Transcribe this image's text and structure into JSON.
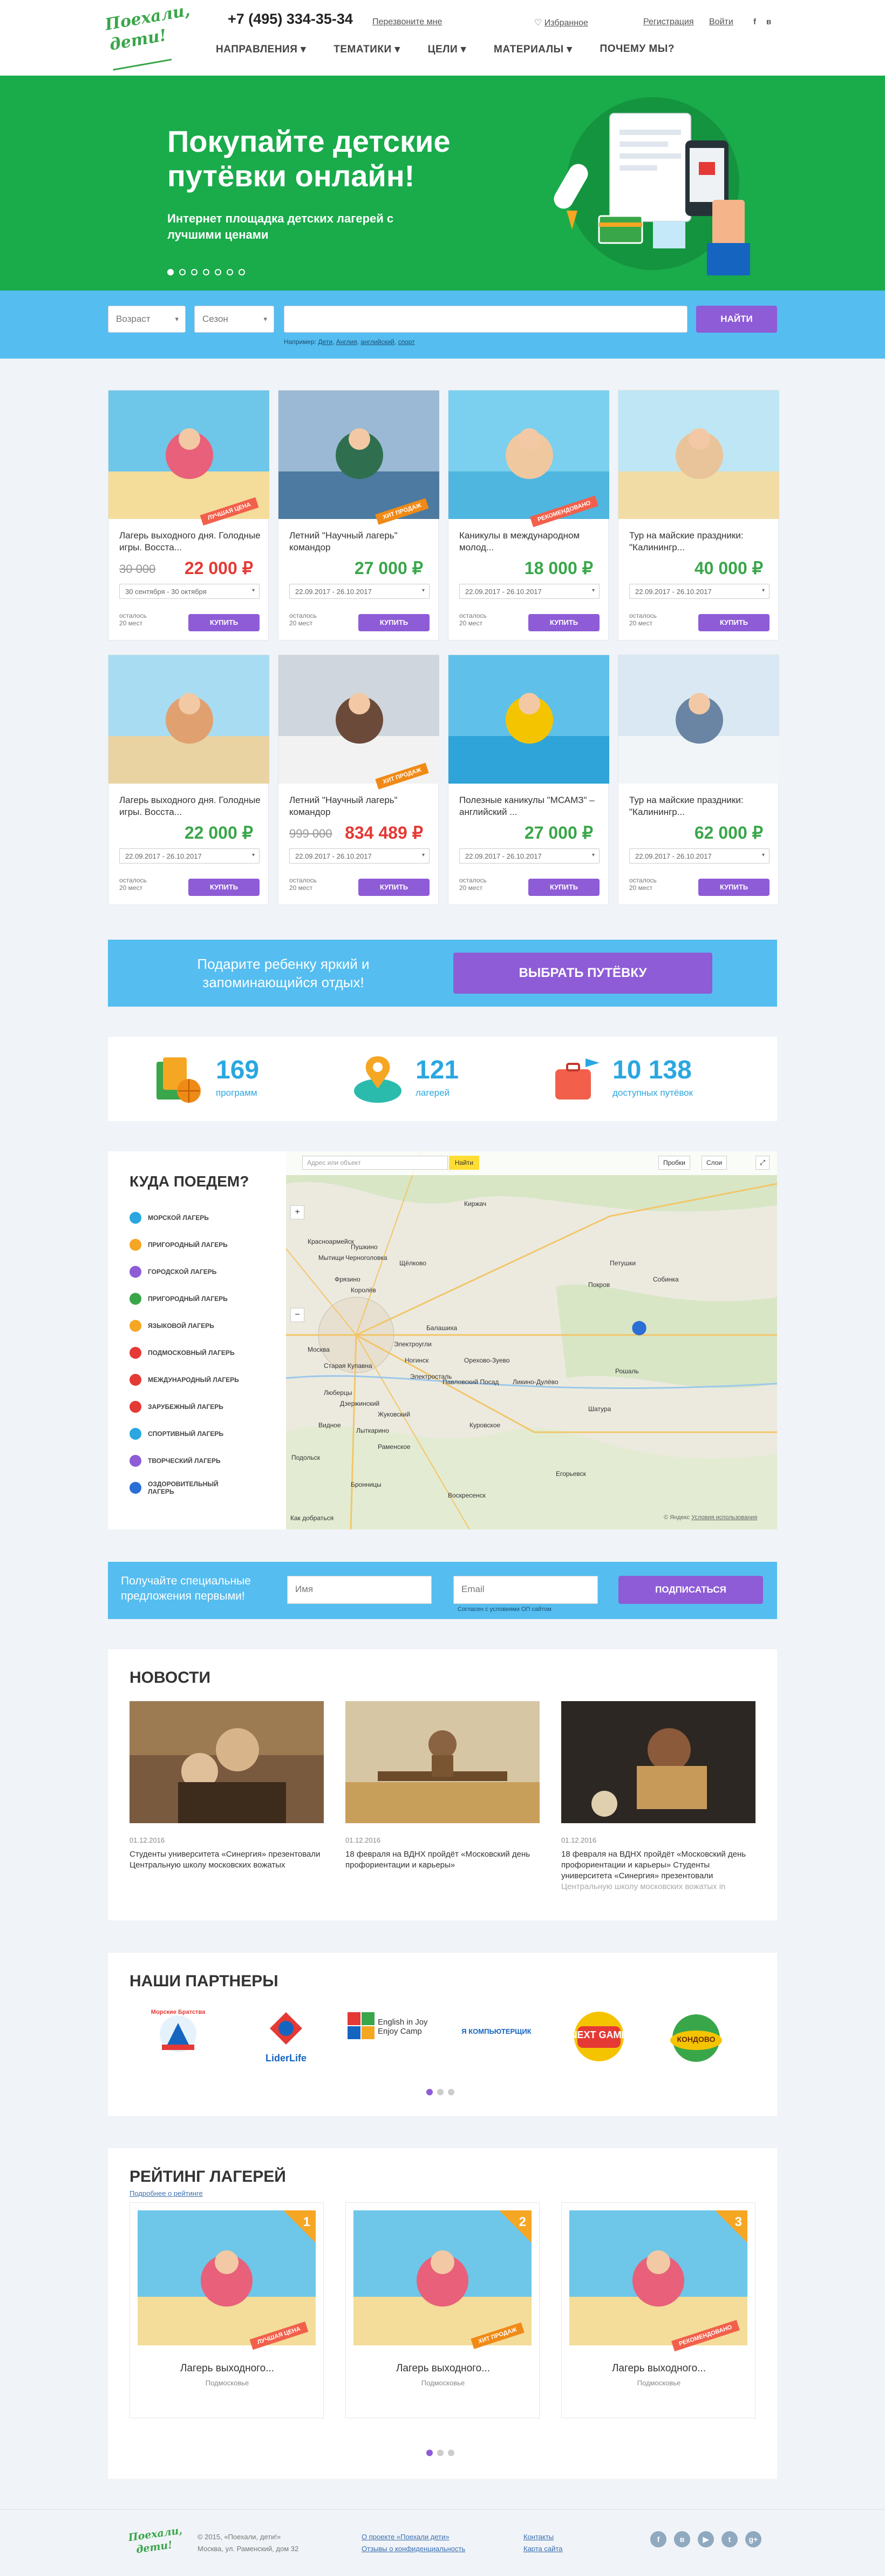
{
  "header": {
    "logo_text": "Поехали, дети!",
    "phone": "+7 (495) 334-35-34",
    "callback": "Перезвоните мне",
    "favorites": "Избранное",
    "register": "Регистрация",
    "login": "Войти",
    "social": [
      "f",
      "в"
    ],
    "nav": [
      {
        "label": "НАПРАВЛЕНИЯ",
        "arrow": "▾"
      },
      {
        "label": "ТЕМАТИКИ",
        "arrow": "▾"
      },
      {
        "label": "ЦЕЛИ",
        "arrow": "▾"
      },
      {
        "label": "МАТЕРИАЛЫ",
        "arrow": "▾"
      },
      {
        "label": "ПОЧЕМУ МЫ?",
        "arrow": ""
      }
    ]
  },
  "hero": {
    "title": "Покупайте детские путёвки онлайн!",
    "subtitle": "Интернет площадка детских лагерей с лучшими ценами",
    "slides": 7,
    "active_slide": 0
  },
  "search": {
    "age": "Возраст",
    "season": "Сезон",
    "button": "НАЙТИ",
    "hint_prefix": "Например:",
    "hint_links": [
      "Дети",
      "Англия",
      "английский",
      "спорт"
    ]
  },
  "cards": [
    {
      "title": "Лагерь выходного дня. Голодные игры. Восста...",
      "old_price": "30 000",
      "price": "22 000 ₽",
      "dates": "30 сентября - 30 октября",
      "left": "осталось",
      "left_count": "20 мест",
      "buy": "КУПИТЬ",
      "ribbon": "ЛУЧШАЯ ЦЕНА"
    },
    {
      "title": "Летний \"Научный лагерь\" командор",
      "old_price": "",
      "price": "27 000 ₽",
      "dates": "22.09.2017 - 26.10.2017",
      "left": "осталось",
      "left_count": "20 мест",
      "buy": "КУПИТЬ",
      "ribbon": "ХИТ ПРОДАЖ"
    },
    {
      "title": "Каникулы в международном молод...",
      "old_price": "",
      "price": "18 000 ₽",
      "dates": "22.09.2017 - 26.10.2017",
      "left": "осталось",
      "left_count": "20 мест",
      "buy": "КУПИТЬ",
      "ribbon": "РЕКОМЕНДОВАНО"
    },
    {
      "title": "Тур на майские праздники: \"Калинингр...",
      "old_price": "",
      "price": "40 000 ₽",
      "dates": "22.09.2017 - 26.10.2017",
      "left": "осталось",
      "left_count": "20 мест",
      "buy": "КУПИТЬ",
      "ribbon": ""
    },
    {
      "title": "Лагерь выходного дня. Голодные игры. Восста...",
      "old_price": "",
      "price": "22 000 ₽",
      "dates": "22.09.2017 - 26.10.2017",
      "left": "осталось",
      "left_count": "20 мест",
      "buy": "КУПИТЬ",
      "ribbon": ""
    },
    {
      "title": "Летний \"Научный лагерь\" командор",
      "old_price": "999 000",
      "price": "834 489 ₽",
      "dates": "22.09.2017 - 26.10.2017",
      "left": "осталось",
      "left_count": "20 мест",
      "buy": "КУПИТЬ",
      "ribbon": "ХИТ ПРОДАЖ"
    },
    {
      "title": "Полезные каникулы \"МСАМЗ\" – английский ...",
      "old_price": "",
      "price": "27 000 ₽",
      "dates": "22.09.2017 - 26.10.2017",
      "left": "осталось",
      "left_count": "20 мест",
      "buy": "КУПИТЬ",
      "ribbon": ""
    },
    {
      "title": "Тур на майские праздники: \"Калинингр...",
      "old_price": "",
      "price": "62 000 ₽",
      "dates": "22.09.2017 - 26.10.2017",
      "left": "осталось",
      "left_count": "20 мест",
      "buy": "КУПИТЬ",
      "ribbon": ""
    }
  ],
  "promo": {
    "text": "Подарите ребенку яркий и запоминающийся отдых!",
    "button": "ВЫБРАТЬ ПУТЁВКУ"
  },
  "stats": [
    {
      "value": "169",
      "label": "программ"
    },
    {
      "value": "121",
      "label": "лагерей"
    },
    {
      "value": "10 138",
      "label": "доступных путёвок"
    }
  ],
  "map_section": {
    "title": "КУДА ПОЕДЕМ?",
    "categories": [
      {
        "label": "МОРСКОЙ ЛАГЕРЬ",
        "color": "#2aa7e0"
      },
      {
        "label": "ПРИГОРОДНЫЙ ЛАГЕРЬ",
        "color": "#f5a623"
      },
      {
        "label": "ГОРОДСКОЙ ЛАГЕРЬ",
        "color": "#8e5cd6"
      },
      {
        "label": "ПРИГОРОДНЫЙ ЛАГЕРЬ",
        "color": "#3aa64a"
      },
      {
        "label": "ЯЗЫКОВОЙ ЛАГЕРЬ",
        "color": "#f5a623"
      },
      {
        "label": "ПОДМОСКОВНЫЙ ЛАГЕРЬ",
        "color": "#e53935"
      },
      {
        "label": "МЕЖДУНАРОДНЫЙ ЛАГЕРЬ",
        "color": "#e53935"
      },
      {
        "label": "ЗАРУБЕЖНЫЙ ЛАГЕРЬ",
        "color": "#e53935"
      },
      {
        "label": "СПОРТИВНЫЙ ЛАГЕРЬ",
        "color": "#2aa7e0"
      },
      {
        "label": "ТВОРЧЕСКИЙ ЛАГЕРЬ",
        "color": "#8e5cd6"
      },
      {
        "label": "ОЗДОРОВИТЕЛЬНЫЙ ЛАГЕРЬ",
        "color": "#2a6fd6"
      }
    ],
    "map": {
      "search_placeholder": "Адрес или объект",
      "find": "Найти",
      "traffic": "Пробки",
      "layers": "Слои",
      "route": "Как добраться",
      "copyright": "© Яндекс",
      "terms": "Условия использования",
      "towns": [
        "Мытищи",
        "Королёв",
        "Щёлково",
        "Балашиха",
        "Москва",
        "Люберцы",
        "Жуковский",
        "Раменское",
        "Электросталь",
        "Ногинск",
        "Орехово-Зуево",
        "Павловский Посад",
        "Куровское",
        "Шатура",
        "Рошаль",
        "Егорьевск",
        "Бронницы",
        "Воскресенск",
        "Пушкино",
        "Фрязино",
        "Красноармейск",
        "Черноголовка",
        "Киржач",
        "Петушки",
        "Покров",
        "Собинка",
        "Ликино-Дулёво",
        "Старая Купавна",
        "Электроугли",
        "Дзержинский",
        "Видное",
        "Подольск",
        "Лыткарино"
      ]
    }
  },
  "subscribe": {
    "text": "Получайте специальные предложения первыми!",
    "name_placeholder": "Имя",
    "email_placeholder": "Email",
    "button": "ПОДПИСАТЬСЯ",
    "agree": "Согласен с условиями ОП сайтом"
  },
  "news": {
    "title": "НОВОСТИ",
    "items": [
      {
        "date": "01.12.2016",
        "text": "Студенты университета «Синергия» презентовали Центральную школу московских вожатых",
        "fade": ""
      },
      {
        "date": "01.12.2016",
        "text": "18 февраля на ВДНХ пройдёт «Московский день профориентации и карьеры»",
        "fade": ""
      },
      {
        "date": "01.12.2016",
        "text": "18 февраля на ВДНХ пройдёт «Московский день профориентации и карьеры» Студенты университета «Синергия» презентовали",
        "fade": "Центральную школу московских вожатых in"
      }
    ]
  },
  "partners": {
    "title": "НАШИ ПАРТНЕРЫ",
    "items": [
      "Морские Братства",
      "LiderLife",
      "English in Joy Enjoy Camp",
      "Я КОМПЬЮТЕРЩИК",
      "NEXT GAME",
      "КОНДОВО"
    ]
  },
  "rating": {
    "title": "РЕЙТИНГ ЛАГЕРЕЙ",
    "more": "Подробнее о рейтинге",
    "items": [
      {
        "num": "1",
        "title": "Лагерь выходного...",
        "sub": "Подмосковье",
        "ribbon": "ЛУЧШАЯ ЦЕНА"
      },
      {
        "num": "2",
        "title": "Лагерь выходного...",
        "sub": "Подмосковье",
        "ribbon": "ХИТ ПРОДАЖ"
      },
      {
        "num": "3",
        "title": "Лагерь выходного...",
        "sub": "Подмосковье",
        "ribbon": "РЕКОМЕНДОВАНО"
      }
    ]
  },
  "footer": {
    "logo_text": "Поехали, дети!",
    "copy": "© 2015, «Поехали, дети!»",
    "address": "Москва, ул. Раменский, дом 32",
    "about": "О проекте «Поехали дети»",
    "legal": "Отзывы о конфиденциальность",
    "contacts": "Контакты",
    "sitemap": "Карта сайта",
    "social": [
      "f",
      "в",
      "▶",
      "t",
      "g+"
    ]
  }
}
